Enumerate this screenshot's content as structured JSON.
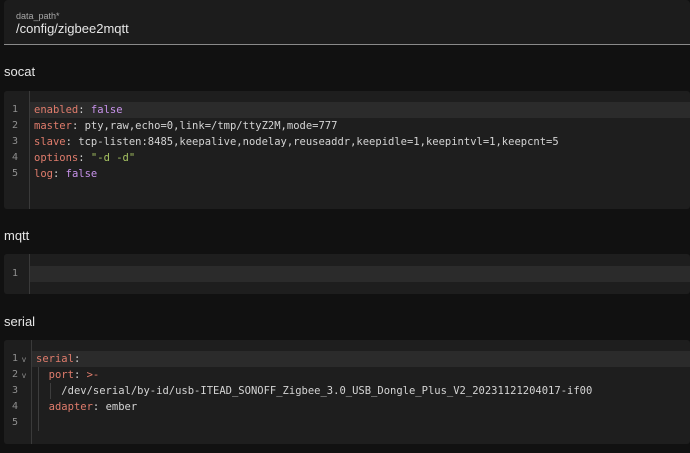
{
  "data_path": {
    "label": "data_path*",
    "value": "/config/zigbee2mqtt"
  },
  "sections": {
    "socat": {
      "title": "socat",
      "lines": [
        {
          "num": "1",
          "key": "enabled",
          "sep": ": ",
          "val": "false",
          "type": "bool"
        },
        {
          "num": "2",
          "key": "master",
          "sep": ": ",
          "val": "pty,raw,echo=0,link=/tmp/ttyZ2M,mode=777",
          "type": "plain"
        },
        {
          "num": "3",
          "key": "slave",
          "sep": ": ",
          "val": "tcp-listen:8485,keepalive,nodelay,reuseaddr,keepidle=1,keepintvl=1,keepcnt=5",
          "type": "plain"
        },
        {
          "num": "4",
          "key": "options",
          "sep": ": ",
          "val": "\"-d -d\"",
          "type": "string"
        },
        {
          "num": "5",
          "key": "log",
          "sep": ": ",
          "val": "false",
          "type": "bool"
        }
      ]
    },
    "mqtt": {
      "title": "mqtt",
      "lines": [
        {
          "num": "1"
        }
      ]
    },
    "serial": {
      "title": "serial",
      "lines": [
        {
          "num": "1",
          "fold": "v",
          "key": "serial",
          "sep": ":",
          "val": "",
          "type": "plain"
        },
        {
          "num": "2",
          "fold": "v",
          "indent": "  ",
          "key": "port",
          "sep": ": ",
          "val": ">-",
          "type": "op"
        },
        {
          "num": "3",
          "indent": "    ",
          "key": "",
          "sep": "",
          "val": "/dev/serial/by-id/usb-ITEAD_SONOFF_Zigbee_3.0_USB_Dongle_Plus_V2_20231121204017-if00",
          "type": "plain"
        },
        {
          "num": "4",
          "indent": "  ",
          "key": "adapter",
          "sep": ": ",
          "val": "ember",
          "type": "plain"
        },
        {
          "num": "5"
        }
      ]
    }
  }
}
